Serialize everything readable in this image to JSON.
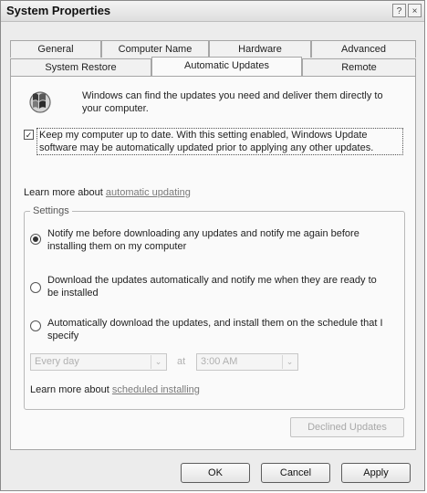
{
  "window": {
    "title": "System Properties",
    "help_glyph": "?",
    "close_glyph": "×"
  },
  "tabs": {
    "row1": [
      "General",
      "Computer Name",
      "Hardware",
      "Advanced"
    ],
    "row2": [
      "System Restore",
      "Automatic Updates",
      "Remote"
    ],
    "active": "Automatic Updates"
  },
  "panel": {
    "icon": "windows-update-icon",
    "intro": "Windows can find the updates you need and deliver them directly to your computer.",
    "keep_updated": {
      "checked": true,
      "check_glyph": "✓",
      "label": "Keep my computer up to date. With this setting enabled, Windows Update software may be automatically updated prior to applying any other updates."
    },
    "learn_more_1": {
      "prefix": "Learn more about",
      "link": "automatic updating"
    },
    "settings": {
      "label": "Settings",
      "options": [
        {
          "label": "Notify me before downloading any updates and notify me again before installing them on my computer",
          "checked": true
        },
        {
          "label": "Download the updates automatically and notify me when they are ready to be installed",
          "checked": false
        },
        {
          "label": "Automatically download the updates, and install them on the schedule that I specify",
          "checked": false
        }
      ],
      "schedule": {
        "day": "Every day",
        "at_label": "at",
        "time": "3:00 AM",
        "arrow_glyph": "⌄"
      },
      "learn_more_2": {
        "prefix": "Learn more about",
        "link": "scheduled installing"
      }
    },
    "declined_button": "Declined Updates"
  },
  "buttons": {
    "ok": "OK",
    "cancel": "Cancel",
    "apply": "Apply"
  }
}
